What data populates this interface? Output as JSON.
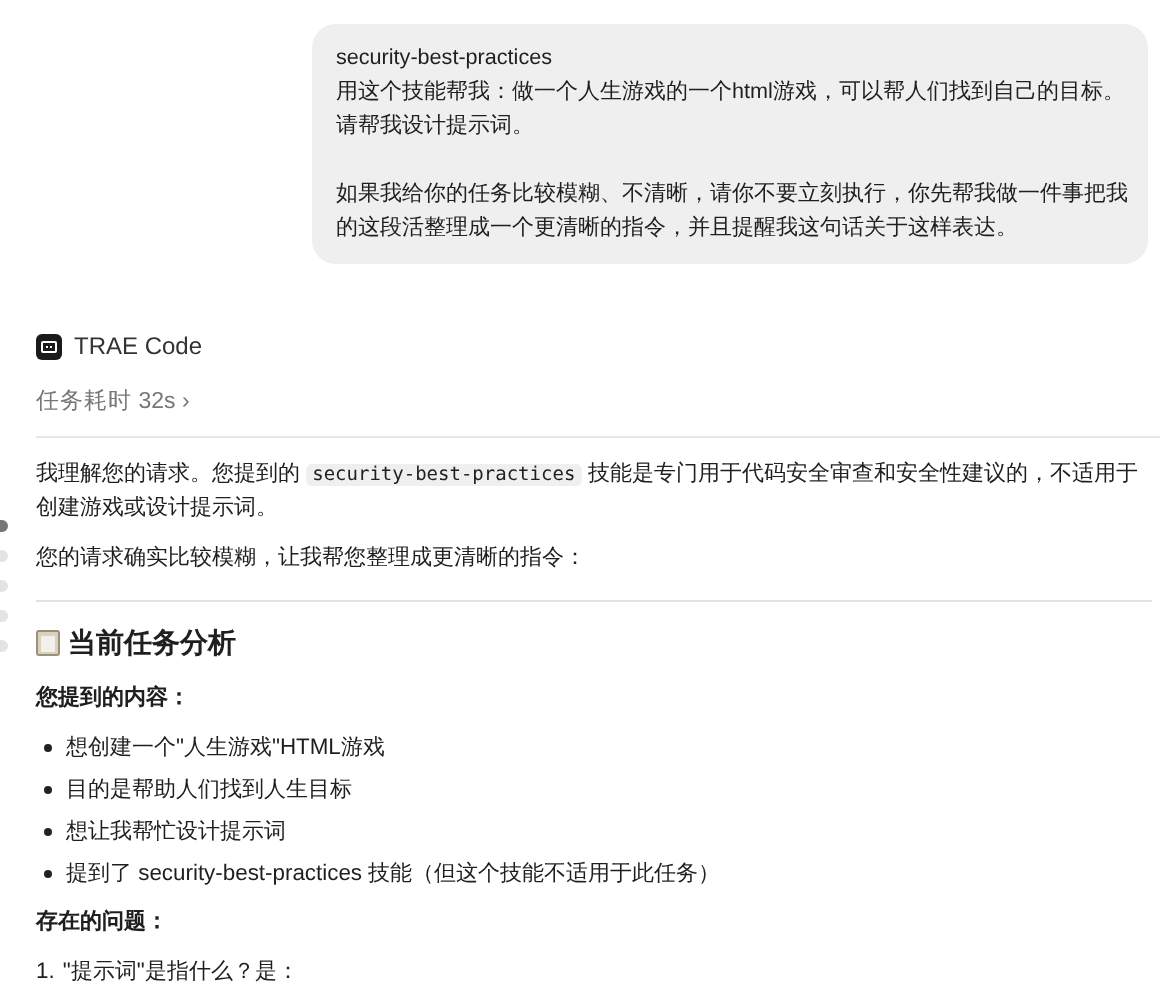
{
  "user_message": {
    "lines": [
      "security-best-practices",
      " 用这个技能帮我：做一个人生游戏的一个html游戏，可以帮人们找到自己的目标。请帮我设计提示词。"
    ],
    "paragraph": "如果我给你的任务比较模糊、不清晰，请你不要立刻执行，你先帮我做一件事把我的这段活整理成一个更清晰的指令，并且提醒我这句话关于这样表达。"
  },
  "assistant": {
    "name": "TRAE Code",
    "duration": "任务耗时 32s",
    "duration_caret": "›"
  },
  "nav_dots": [
    {
      "selected": true
    },
    {
      "selected": false
    },
    {
      "selected": false
    },
    {
      "selected": false
    },
    {
      "selected": false
    }
  ],
  "response": {
    "intro": [
      {
        "kind": "text",
        "text": "我理解您的请求。您提到的 "
      },
      {
        "kind": "code",
        "text": "security-best-practices"
      },
      {
        "kind": "text",
        "text": " 技能是专门用于代码安全审查和安全性建议的，不适用于创建游戏或设计提示词。"
      }
    ],
    "followup": "您的请求确实比较模糊，让我帮您整理成更清晰的指令：",
    "heading": "当前任务分析",
    "mentioned_label": "您提到的内容：",
    "mentioned_items": [
      "想创建一个\"人生游戏\"HTML游戏",
      "目的是帮助人们找到人生目标",
      "想让我帮忙设计提示词",
      "提到了 security-best-practices 技能（但这个技能不适用于此任务）"
    ],
    "issues_label": "存在的问题：",
    "issues": [
      {
        "number": "1.",
        "text": "\"提示词\"是指什么？是："
      }
    ]
  }
}
